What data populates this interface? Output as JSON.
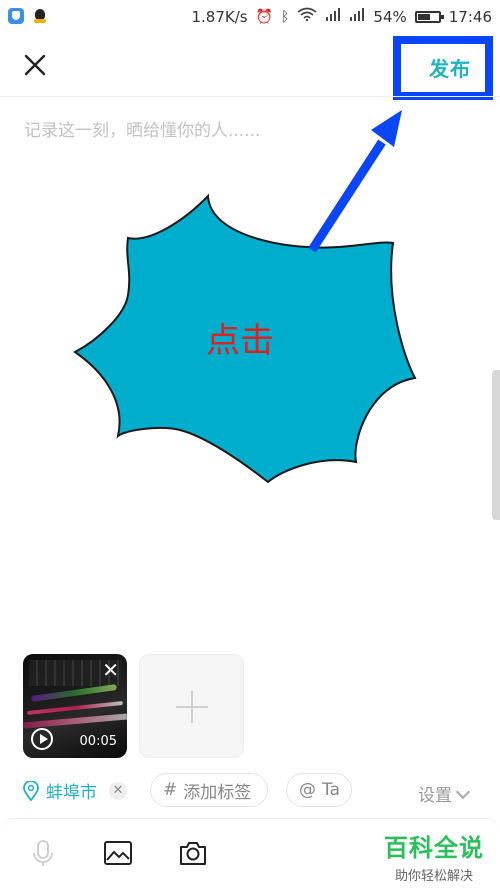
{
  "status_bar": {
    "speed": "1.87K/s",
    "battery_percent": "54%",
    "time": "17:46",
    "icons": [
      "alarm-icon",
      "bluetooth-icon",
      "wifi-icon",
      "signal-icon",
      "signal-icon",
      "battery-icon"
    ]
  },
  "header": {
    "close_icon": "close-icon",
    "publish_label": "发布"
  },
  "composer": {
    "placeholder": "记录这一刻，晒给懂你的人......"
  },
  "annotation": {
    "callout_text": "点击",
    "callout_color": "#00adcc",
    "arrow_color": "#0b46f6",
    "highlight_color": "#0b46f6"
  },
  "media": {
    "video_duration": "00:05",
    "remove_icon": "close-icon",
    "play_icon": "play-icon",
    "add_icon": "plus-icon"
  },
  "tags_row": {
    "location": "蚌埠市",
    "add_tag_label": "添加标签",
    "mention_label": "Ta",
    "settings_label": "设置"
  },
  "toolbar": {
    "icons": [
      "microphone-icon",
      "image-icon",
      "camera-icon"
    ]
  },
  "watermark": {
    "title": "百科全说",
    "subtitle": "助你轻松解决"
  },
  "colors": {
    "accent": "#1fb3bf",
    "watermark_green": "#2bbf5a"
  }
}
